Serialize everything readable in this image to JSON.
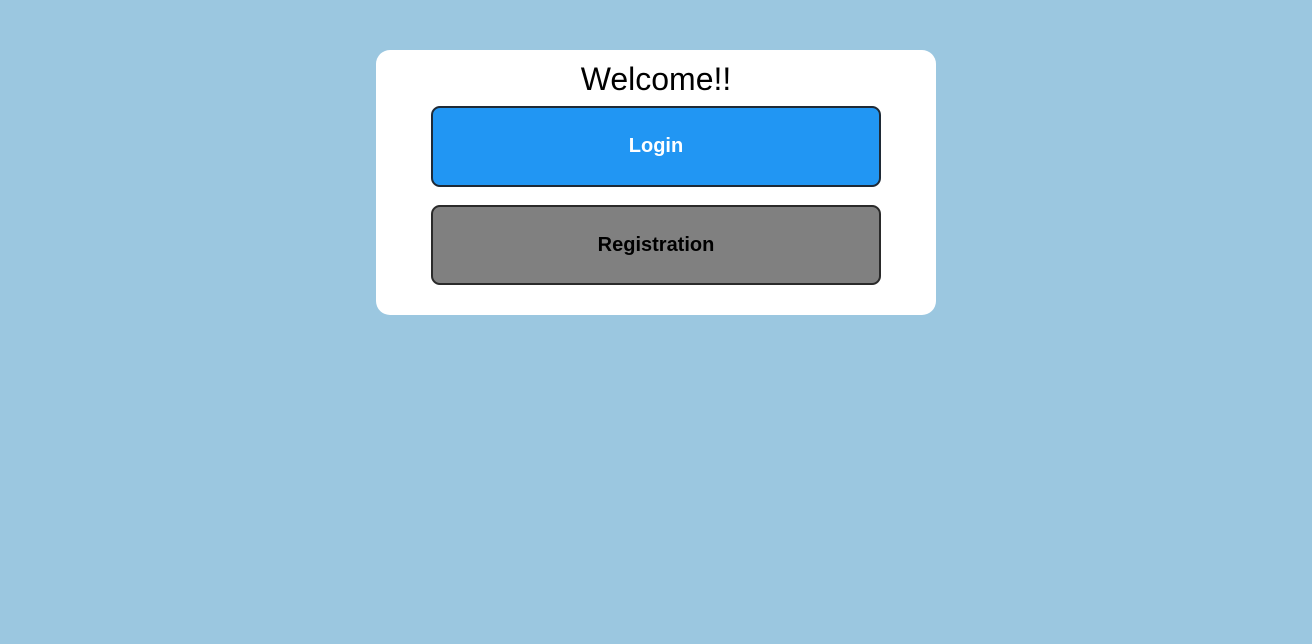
{
  "page": {
    "background_color": "#9bc7e0"
  },
  "card": {
    "title": "Welcome!!",
    "background_color": "#ffffff"
  },
  "buttons": {
    "login": {
      "label": "Login",
      "background_color": "#2196f3",
      "text_color": "#ffffff"
    },
    "registration": {
      "label": "Registration",
      "background_color": "#808080",
      "text_color": "#000000"
    }
  }
}
